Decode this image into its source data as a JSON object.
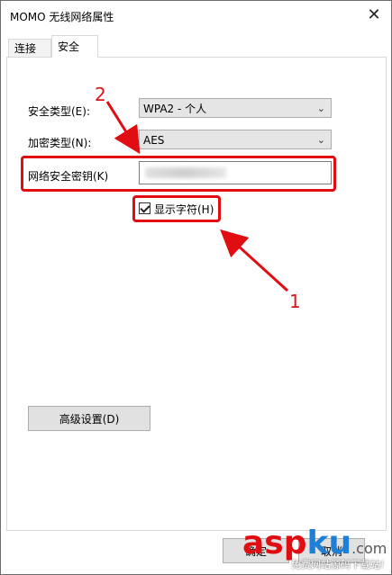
{
  "window": {
    "title": "MOMO 无线网络属性",
    "close_glyph": "✕"
  },
  "tabs": [
    {
      "label": "连接"
    },
    {
      "label": "安全"
    }
  ],
  "security": {
    "security_type_label": "安全类型(E):",
    "security_type_value": "WPA2 - 个人",
    "encryption_type_label": "加密类型(N):",
    "encryption_type_value": "AES",
    "network_key_label": "网络安全密钥(K)",
    "show_chars_label": "显示字符(H)",
    "show_chars_checked": true
  },
  "buttons": {
    "advanced_label": "高级设置(D)",
    "ok_label": "确定",
    "cancel_label": "取消"
  },
  "annotations": {
    "num1": "1",
    "num2": "2",
    "color": "#e00d13"
  },
  "watermark": {
    "main": "aspku",
    "suffix": ".com",
    "sub": "免费网站源码下载站!"
  },
  "icons": {
    "chevron": "chevron-down-icon",
    "check": "check-icon"
  }
}
